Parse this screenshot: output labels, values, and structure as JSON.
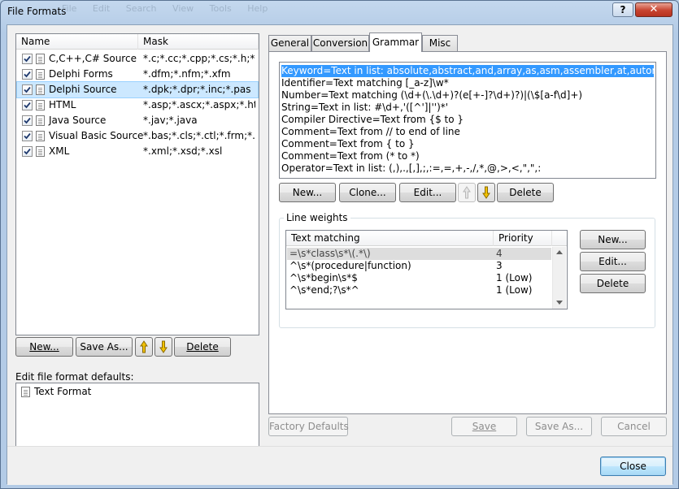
{
  "window": {
    "title": "File Formats",
    "ghost_menu": [
      "File",
      "Edit",
      "Search",
      "View",
      "Tools",
      "Help"
    ],
    "help_label": "?",
    "close_glyph": "✕"
  },
  "formats": {
    "columns": {
      "name": "Name",
      "mask": "Mask"
    },
    "rows": [
      {
        "name": "C,C++,C# Source",
        "mask": "*.c;*.cc;*.cpp;*.cs;*.h;*....",
        "checked": true
      },
      {
        "name": "Delphi Forms",
        "mask": "*.dfm;*.nfm;*.xfm",
        "checked": true
      },
      {
        "name": "Delphi Source",
        "mask": "*.dpk;*.dpr;*.inc;*.pas",
        "checked": true,
        "selected": true
      },
      {
        "name": "HTML",
        "mask": "*.asp;*.ascx;*.aspx;*.ht...",
        "checked": true
      },
      {
        "name": "Java Source",
        "mask": "*.jav;*.java",
        "checked": true
      },
      {
        "name": "Visual Basic Source",
        "mask": "*.bas;*.cls;*.ctl;*.frm;*.v...",
        "checked": true
      },
      {
        "name": "XML",
        "mask": "*.xml;*.xsd;*.xsl",
        "checked": true
      }
    ],
    "new_label": "New...",
    "save_as_label": "Save As...",
    "delete_label": "Delete",
    "defaults_label": "Edit file format defaults:",
    "defaults_items": [
      "Text Format"
    ]
  },
  "tabs": [
    "General",
    "Conversion",
    "Grammar",
    "Misc"
  ],
  "active_tab": "Grammar",
  "grammar": {
    "lines": [
      "Keyword=Text in list: absolute,abstract,and,array,as,asm,assembler,at,automated,begin",
      "Identifier=Text matching [_a-z]\\w*",
      "Number=Text matching (\\d+(\\.\\d+)?(e[+-]?\\d+)?)|(\\$[a-f\\d]+)",
      "String=Text in list: #\\d+,'([^']|'')*'",
      "Compiler Directive=Text from {$ to }",
      "Comment=Text from // to end of line",
      "Comment=Text from { to }",
      "Comment=Text from (* to *)",
      "Operator=Text in list: (,),.,[,],;,:=,=,+,-,/,*,@,>,<,\",\",:"
    ],
    "new_label": "New...",
    "clone_label": "Clone...",
    "edit_label": "Edit...",
    "delete_label": "Delete"
  },
  "line_weights": {
    "group_label": "Line weights",
    "columns": {
      "text": "Text matching",
      "priority": "Priority"
    },
    "rows": [
      {
        "text": "=\\s*class\\s*\\(.*\\)",
        "priority": "4",
        "selected": true
      },
      {
        "text": "^\\s*(procedure|function)",
        "priority": "3"
      },
      {
        "text": "^\\s*begin\\s*$",
        "priority": "1 (Low)"
      },
      {
        "text": "^\\s*end;?\\s*^",
        "priority": "1 (Low)"
      }
    ],
    "new_label": "New...",
    "edit_label": "Edit...",
    "delete_label": "Delete"
  },
  "footer": {
    "factory_label": "Factory Defaults",
    "save_label": "Save",
    "save_as_label": "Save As...",
    "cancel_label": "Cancel",
    "close_label": "Close"
  },
  "colors": {
    "selection": "#3399ff",
    "row_highlight": "#cce8ff",
    "arrow": "#f2c200"
  }
}
